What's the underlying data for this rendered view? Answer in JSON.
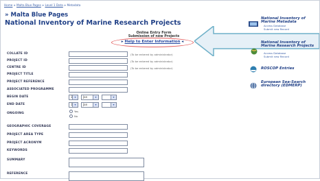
{
  "breadcrumb": {
    "home": "Home",
    "level1": "Malta Blue Pages",
    "level2": "Level 1 Data",
    "current": "Metadata",
    "sep": " » "
  },
  "page": {
    "title1": "» Malta Blue Pages",
    "title2": "National Inventory of Marine Research Projects",
    "online_form": "Online Entry Form",
    "submission": "Submission of new Projects",
    "help_link": "Help to Enter Information"
  },
  "form": {
    "rows": [
      {
        "label": "COLLATE ID",
        "note": "(To be entered by administrator)"
      },
      {
        "label": "PROJECT ID",
        "note": "(To be entered by administrator)"
      },
      {
        "label": "CENTRE ID",
        "note": "(To be entered by administrator)"
      },
      {
        "label": "PROJECT TITLE",
        "note": ""
      },
      {
        "label": "PROJECT REFERENCE",
        "note": ""
      },
      {
        "label": "ASSOCIATED PROGRAMME",
        "note": ""
      },
      {
        "label": "BEGIN DATE",
        "note": ""
      },
      {
        "label": "END DATE",
        "note": ""
      },
      {
        "label": "ONGOING",
        "note": ""
      },
      {
        "label": "GEOGRAPHIC COVERAGE",
        "note": ""
      },
      {
        "label": "PROJECT AREA TYPE",
        "note": ""
      },
      {
        "label": "PROJECT ACRONYM",
        "note": ""
      },
      {
        "label": "KEYWORDS",
        "note": ""
      },
      {
        "label": "SUMMARY",
        "note": ""
      },
      {
        "label": "REFERENCE",
        "note": ""
      }
    ],
    "begin_date": {
      "day": "1",
      "month": "Jan"
    },
    "end_date": {
      "day": "1",
      "month": "Jan"
    },
    "ongoing_options": [
      "Yes",
      "No"
    ]
  },
  "sidebar": [
    {
      "title": "National Inventory of Marine Metadata",
      "links": [
        "Access Database",
        "Submit new Record"
      ],
      "icon": "database-icon"
    },
    {
      "title": "National Inventory of Marine Research Projects",
      "links": [
        "Access Database",
        "Submit new Record"
      ],
      "icon": "globe-icon"
    },
    {
      "title": "ROSCOP Entries",
      "links": [],
      "icon": "ship-icon"
    },
    {
      "title": "European Sea-Search directory (EDMERP)",
      "links": [],
      "icon": "globe-icon"
    }
  ],
  "colors": {
    "accent": "#1f3f86",
    "highlight": "#e25a5a",
    "arrow_fill": "#e6f0f7"
  }
}
